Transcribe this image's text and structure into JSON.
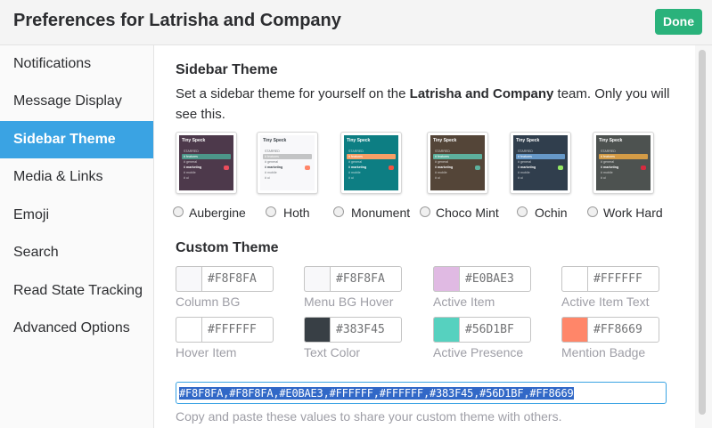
{
  "header": {
    "title": "Preferences for Latrisha and Company",
    "done_label": "Done"
  },
  "nav": [
    {
      "label": "Notifications",
      "active": false
    },
    {
      "label": "Message Display",
      "active": false
    },
    {
      "label": "Sidebar Theme",
      "active": true
    },
    {
      "label": "Media & Links",
      "active": false
    },
    {
      "label": "Emoji",
      "active": false
    },
    {
      "label": "Search",
      "active": false
    },
    {
      "label": "Read State Tracking",
      "active": false
    },
    {
      "label": "Advanced Options",
      "active": false
    }
  ],
  "sidebar_theme": {
    "heading": "Sidebar Theme",
    "desc_before": "Set a sidebar theme for yourself on the ",
    "desc_team": "Latrisha and Company",
    "desc_after": " team. Only you will see this.",
    "preview": {
      "team": "Tiny Speck",
      "starred": "STARRED",
      "channels": [
        "# features",
        "# general",
        "# marketing",
        "# mobile",
        "# ui"
      ],
      "badge": "1"
    },
    "themes": [
      {
        "name": "Aubergine",
        "bg": "#4d394b",
        "sel": "#4c9689",
        "text": "#ffffff",
        "badge": "#eb4d5c"
      },
      {
        "name": "Hoth",
        "bg": "#f8f8fa",
        "sel": "#c3c4c5",
        "text": "#383f45",
        "badge": "#ff8669"
      },
      {
        "name": "Monument",
        "bg": "#0d7e83",
        "sel": "#f79f66",
        "text": "#ffffff",
        "badge": "#f15340"
      },
      {
        "name": "Choco Mint",
        "bg": "#544538",
        "sel": "#5db09d",
        "text": "#ffffff",
        "badge": "#5db09d"
      },
      {
        "name": "Ochin",
        "bg": "#303e4d",
        "sel": "#6698c8",
        "text": "#ffffff",
        "badge": "#94e864"
      },
      {
        "name": "Work Hard",
        "bg": "#4d5250",
        "sel": "#d39b46",
        "text": "#ffffff",
        "badge": "#d72b3f"
      }
    ]
  },
  "custom_theme": {
    "heading": "Custom Theme",
    "fields": [
      {
        "hex": "#F8F8FA",
        "label": "Column BG",
        "color": "#f8f8fa"
      },
      {
        "hex": "#F8F8FA",
        "label": "Menu BG Hover",
        "color": "#f8f8fa"
      },
      {
        "hex": "#E0BAE3",
        "label": "Active Item",
        "color": "#e0bae3"
      },
      {
        "hex": "#FFFFFF",
        "label": "Active Item Text",
        "color": "#ffffff"
      },
      {
        "hex": "#FFFFFF",
        "label": "Hover Item",
        "color": "#ffffff"
      },
      {
        "hex": "#383F45",
        "label": "Text Color",
        "color": "#383f45"
      },
      {
        "hex": "#56D1BF",
        "label": "Active Presence",
        "color": "#56d1bf"
      },
      {
        "hex": "#FF8669",
        "label": "Mention Badge",
        "color": "#ff8669"
      }
    ],
    "share_value": "#F8F8FA,#F8F8FA,#E0BAE3,#FFFFFF,#FFFFFF,#383F45,#56D1BF,#FF8669",
    "share_help": "Copy and paste these values to share your custom theme with others."
  }
}
